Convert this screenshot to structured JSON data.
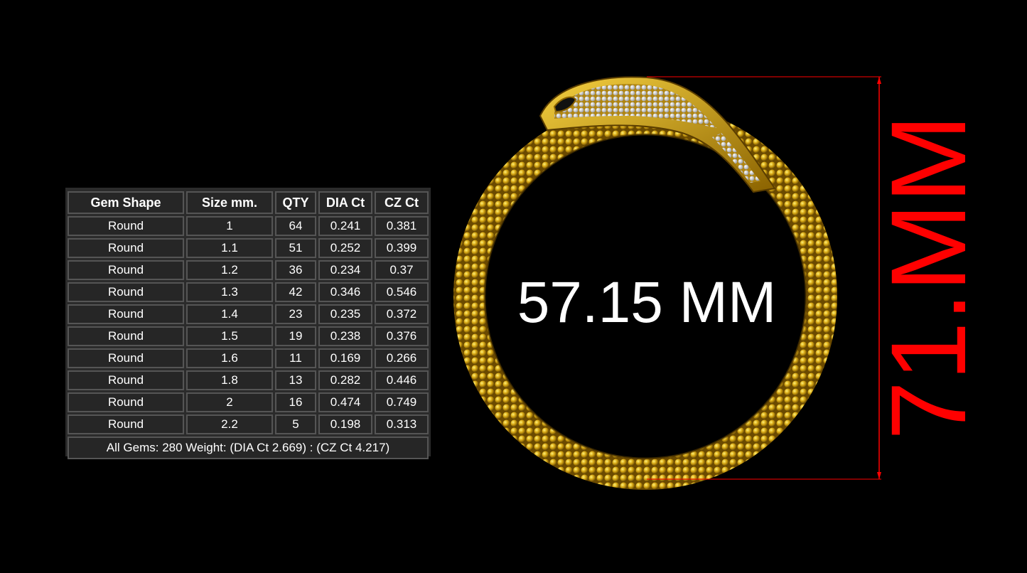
{
  "table": {
    "headers": [
      "Gem Shape",
      "Size mm.",
      "QTY",
      "DIA Ct",
      "CZ Ct"
    ],
    "rows": [
      [
        "Round",
        "1",
        "64",
        "0.241",
        "0.381"
      ],
      [
        "Round",
        "1.1",
        "51",
        "0.252",
        "0.399"
      ],
      [
        "Round",
        "1.2",
        "36",
        "0.234",
        "0.37"
      ],
      [
        "Round",
        "1.3",
        "42",
        "0.346",
        "0.546"
      ],
      [
        "Round",
        "1.4",
        "23",
        "0.235",
        "0.372"
      ],
      [
        "Round",
        "1.5",
        "19",
        "0.238",
        "0.376"
      ],
      [
        "Round",
        "1.6",
        "11",
        "0.169",
        "0.266"
      ],
      [
        "Round",
        "1.8",
        "13",
        "0.282",
        "0.446"
      ],
      [
        "Round",
        "2",
        "16",
        "0.474",
        "0.749"
      ],
      [
        "Round",
        "2.2",
        "5",
        "0.198",
        "0.313"
      ]
    ],
    "summary": "All Gems: 280  Weight: (DIA Ct 2.669) : (CZ Ct 4.217)"
  },
  "dimensions": {
    "inner_diameter": "57.15 MM",
    "outer_height": "71.MM"
  },
  "colors": {
    "gold": "#d4a017",
    "dimension_red": "#ff0000",
    "background": "#000000"
  }
}
